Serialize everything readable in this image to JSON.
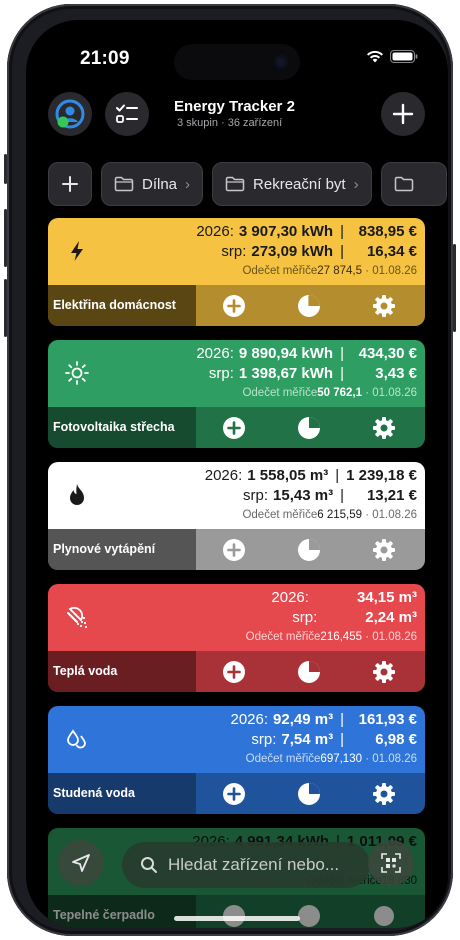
{
  "status": {
    "time": "21:09"
  },
  "header": {
    "title": "Energy Tracker 2",
    "subtitle": "3 skupin · 36 zařízení"
  },
  "groups": [
    {
      "label": "Dílna"
    },
    {
      "label": "Rekreační byt"
    }
  ],
  "cards": [
    {
      "name": "Elektřina domácnost",
      "icon": "bolt-icon",
      "row1": {
        "label": "2026:",
        "value": "3 907,30 kWh",
        "cost": "838,95 €"
      },
      "row2": {
        "label": "srp:",
        "value": "273,09 kWh",
        "cost": "16,34 €"
      },
      "meter": {
        "label": "Odečet měřiče",
        "value": "27 874,5",
        "date": "· 01.08.26"
      },
      "colors": {
        "top": "#f5c242",
        "bottom": "#b48e2e",
        "name": "#5a4612"
      }
    },
    {
      "name": "Fotovoltaika střecha",
      "icon": "sun-icon",
      "row1": {
        "label": "2026:",
        "value": "9 890,94 kWh",
        "cost": "434,30 €"
      },
      "row2": {
        "label": "srp:",
        "value": "1 398,67 kWh",
        "cost": "3,43 €"
      },
      "meter": {
        "label": "Odečet měřiče",
        "value": "50 762,1",
        "date": "· 01.08.26"
      },
      "colors": {
        "top": "#2e9e62",
        "bottom": "#217347",
        "name": "#164b2f"
      }
    },
    {
      "name": "Plynové vytápění",
      "icon": "flame-icon",
      "row1": {
        "label": "2026:",
        "value": "1 558,05 m³",
        "cost": "1 239,18 €"
      },
      "row2": {
        "label": "srp:",
        "value": "15,43 m³",
        "cost": "13,21 €"
      },
      "meter": {
        "label": "Odečet měřiče",
        "value": "6 215,59",
        "date": "· 01.08.26"
      },
      "colors": {
        "top": "#ffffff",
        "bottom": "#9a9a9a",
        "name": "#555555"
      }
    },
    {
      "name": "Teplá voda",
      "icon": "shower-icon",
      "row1": {
        "label": "2026:",
        "value": "34,15 m³",
        "cost": ""
      },
      "row2": {
        "label": "srp:",
        "value": "2,24 m³",
        "cost": ""
      },
      "meter": {
        "label": "Odečet měřiče",
        "value": "216,455",
        "date": "· 01.08.26"
      },
      "colors": {
        "top": "#e5484d",
        "bottom": "#a83238",
        "name": "#6b1e22"
      }
    },
    {
      "name": "Studená voda",
      "icon": "drops-icon",
      "row1": {
        "label": "2026:",
        "value": "92,49 m³",
        "cost": "161,93 €"
      },
      "row2": {
        "label": "srp:",
        "value": "7,54 m³",
        "cost": "6,98 €"
      },
      "meter": {
        "label": "Odečet měřiče",
        "value": "697,130",
        "date": "· 01.08.26"
      },
      "colors": {
        "top": "#2f74d8",
        "bottom": "#1f539c",
        "name": "#163a6c"
      }
    },
    {
      "name": "Tepelné čerpadlo",
      "icon": "",
      "row1": {
        "label": "2026:",
        "value": "4 991,34 kWh",
        "cost": "1 011,09 €"
      },
      "row2": {
        "label": "",
        "value": "",
        "cost": ""
      },
      "meter": {
        "label": "Odečet měřiče",
        "value": "18 830",
        "date": ""
      },
      "colors": {
        "top": "#2e9e62",
        "bottom": "#217347",
        "name": "#164b2f"
      }
    }
  ],
  "search": {
    "placeholder": "Hledat zařízení nebo..."
  }
}
